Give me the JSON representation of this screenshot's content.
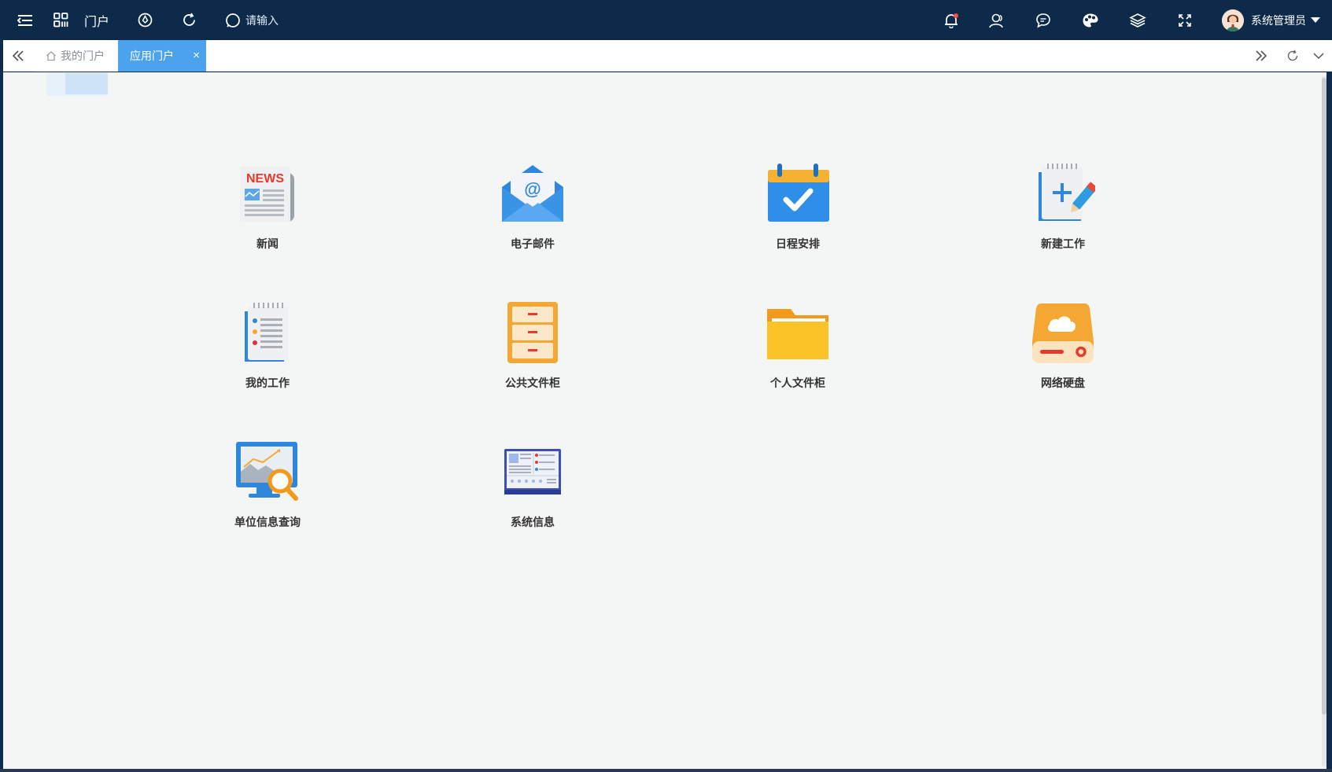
{
  "topbar": {
    "portal_label": "门户",
    "search_placeholder": "请输入",
    "user_name": "系统管理员"
  },
  "tabs": {
    "home_label": "我的门户",
    "active_label": "应用门户",
    "close_symbol": "×"
  },
  "apps": [
    {
      "label": "新闻",
      "icon": "news-icon"
    },
    {
      "label": "电子邮件",
      "icon": "email-icon"
    },
    {
      "label": "日程安排",
      "icon": "calendar-icon"
    },
    {
      "label": "新建工作",
      "icon": "new-work-icon"
    },
    {
      "label": "我的工作",
      "icon": "my-work-icon"
    },
    {
      "label": "公共文件柜",
      "icon": "public-cabinet-icon"
    },
    {
      "label": "个人文件柜",
      "icon": "personal-folder-icon"
    },
    {
      "label": "网络硬盘",
      "icon": "network-disk-icon"
    },
    {
      "label": "单位信息查询",
      "icon": "org-info-query-icon"
    },
    {
      "label": "系统信息",
      "icon": "system-info-icon"
    }
  ],
  "colors": {
    "topbar_bg": "#0d2a4a",
    "tab_active_bg": "#4aa3ec",
    "content_bg": "#f4f5f5"
  }
}
